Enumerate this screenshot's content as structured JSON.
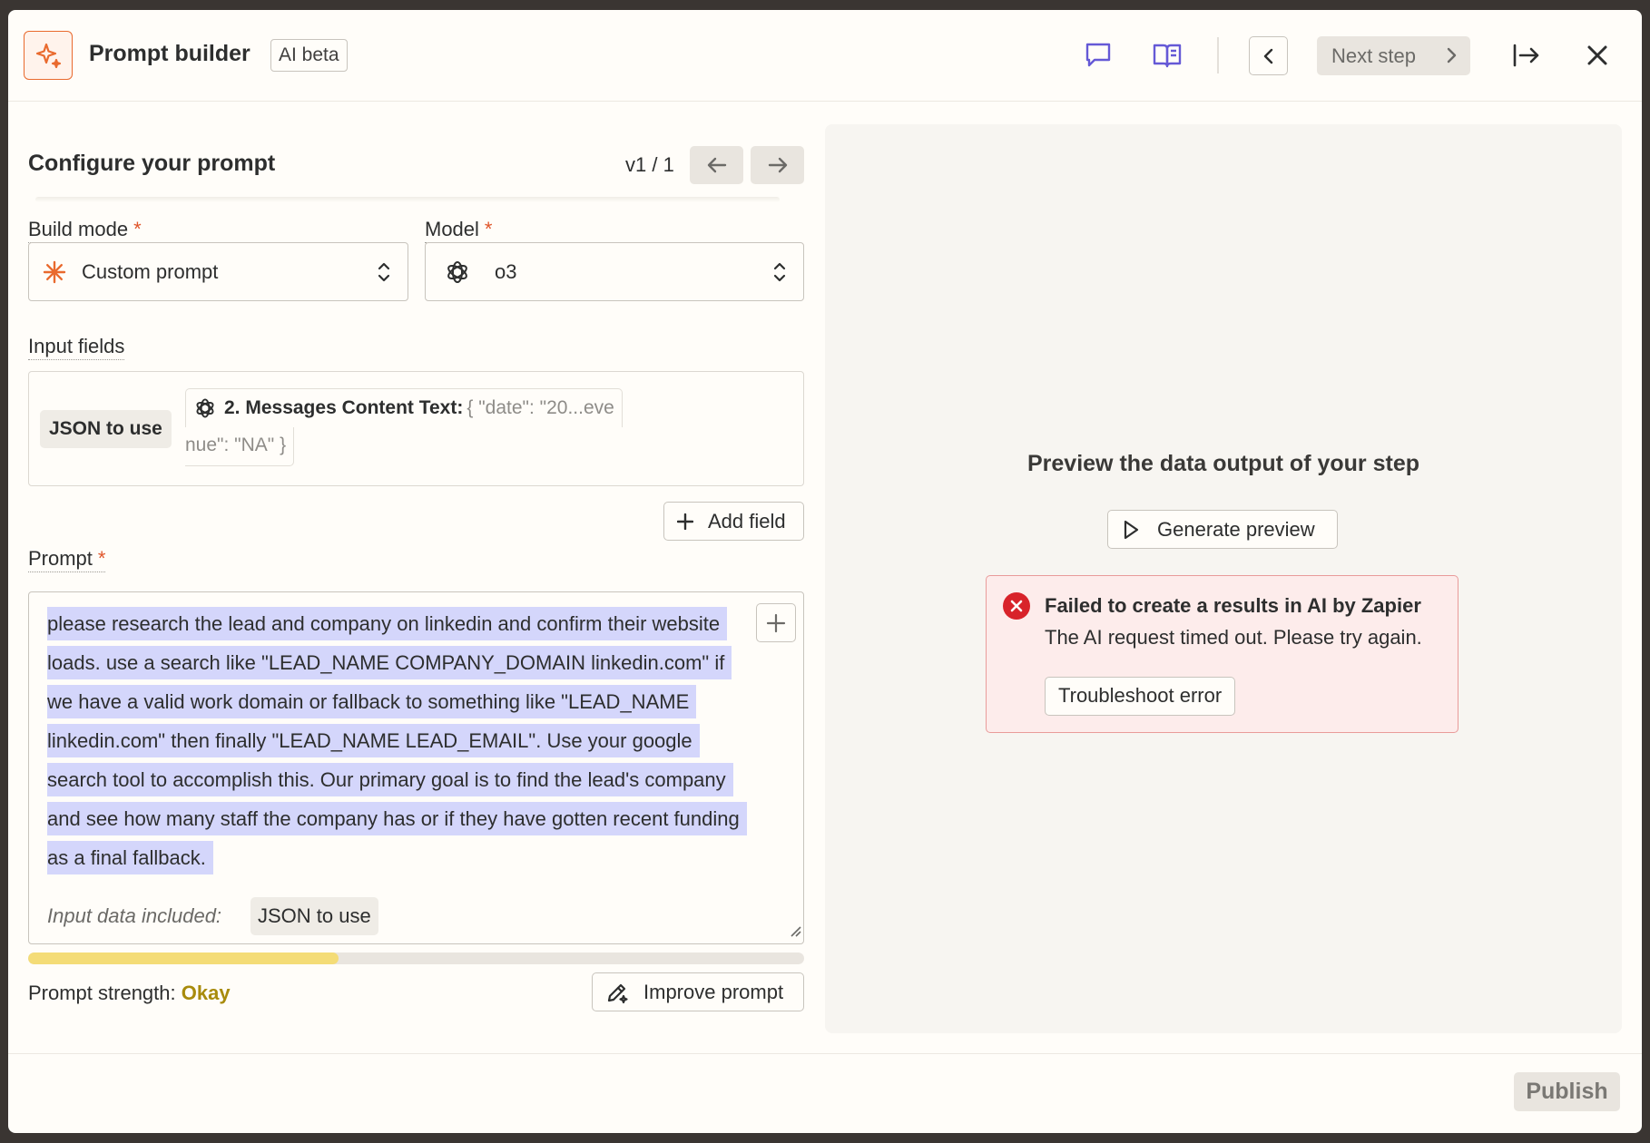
{
  "header": {
    "title": "Prompt builder",
    "badge": "AI beta",
    "next_step_label": "Next step"
  },
  "config": {
    "section_title": "Configure your prompt",
    "version": "v1 / 1",
    "build_mode": {
      "label": "Build mode",
      "value": "Custom prompt"
    },
    "model": {
      "label": "Model",
      "value": "o3"
    },
    "input_fields": {
      "label": "Input fields",
      "field_name": "JSON to use",
      "token_title": "2. Messages Content Text:",
      "token_preview_1": "{   \"date\": \"20...eve",
      "token_preview_2": "nue\": \"NA\" }"
    },
    "add_field_label": "Add field",
    "prompt": {
      "label": "Prompt",
      "text": "please research the lead and company on linkedin and confirm their website loads. use a search like \"LEAD_NAME COMPANY_DOMAIN linkedin.com\" if we have a valid work domain or fallback to something like \"LEAD_NAME linkedin.com\" then finally \"LEAD_NAME LEAD_EMAIL\". Use your google search tool to accomplish this. Our primary goal is to find the lead's company and see how many staff the company has or if they have gotten recent funding as a final fallback.",
      "included_label": "Input data included:",
      "included_value": "JSON to use"
    },
    "strength": {
      "label": "Prompt strength:",
      "value": "Okay",
      "fraction": 0.4
    },
    "improve_label": "Improve prompt"
  },
  "preview": {
    "title": "Preview the data output of your step",
    "generate_label": "Generate preview",
    "error": {
      "title": "Failed to create a results in AI by Zapier",
      "message": "The AI request timed out. Please try again.",
      "button": "Troubleshoot error"
    }
  },
  "footer": {
    "publish_label": "Publish"
  },
  "colors": {
    "accent_icon": "#6559d6",
    "brand_orange": "#e96a2e",
    "highlight": "#d4d6fb",
    "strength_bar": "#f4dc77",
    "strength_text": "#a88b0c",
    "error_red": "#d8232a"
  }
}
